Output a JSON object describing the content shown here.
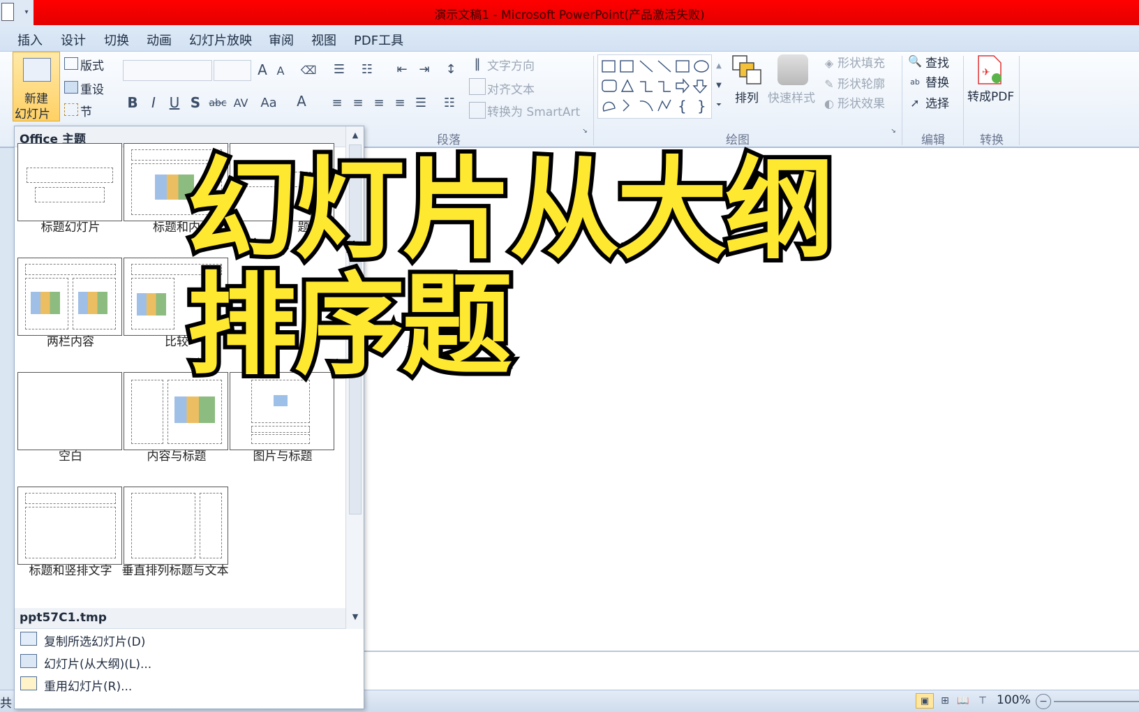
{
  "window": {
    "title": "演示文稿1 - Microsoft PowerPoint(产品激活失败)"
  },
  "tabs": [
    "插入",
    "设计",
    "切换",
    "动画",
    "幻灯片放映",
    "审阅",
    "视图",
    "PDF工具"
  ],
  "ribbon": {
    "new_slide_line1": "新建",
    "new_slide_line2": "幻灯片",
    "layout": "版式",
    "reset": "重设",
    "section": "节",
    "text_direction": "文字方向",
    "align_text": "对齐文本",
    "convert_smartart": "转换为 SmartArt",
    "arrange": "排列",
    "quick_styles": "快速样式",
    "shape_fill": "形状填充",
    "shape_outline": "形状轮廓",
    "shape_effects": "形状效果",
    "find": "查找",
    "replace": "替换",
    "select": "选择",
    "to_pdf": "转成PDF",
    "groups": {
      "paragraph": "段落",
      "drawing": "绘图",
      "editing": "编辑",
      "convert": "转换"
    }
  },
  "gallery": {
    "theme_header": "Office 主题",
    "layouts": [
      "标题幻灯片",
      "标题和内",
      "题",
      "两栏内容",
      "比较",
      "空白",
      "内容与标题",
      "图片与标题",
      "标题和竖排文字",
      "垂直排列标题与文本"
    ],
    "file_header": "ppt57C1.tmp",
    "menu": [
      "复制所选幻灯片(D)",
      "幻灯片(从大纲)(L)...",
      "重用幻灯片(R)..."
    ]
  },
  "overlay": {
    "line1": "幻灯片从大纲",
    "line2": "排序题"
  },
  "status": {
    "left_char": "共",
    "zoom": "100%"
  },
  "colors": {
    "titlebar": "#e60000",
    "overlay_fill": "#ffe930",
    "overlay_stroke": "#000000"
  }
}
